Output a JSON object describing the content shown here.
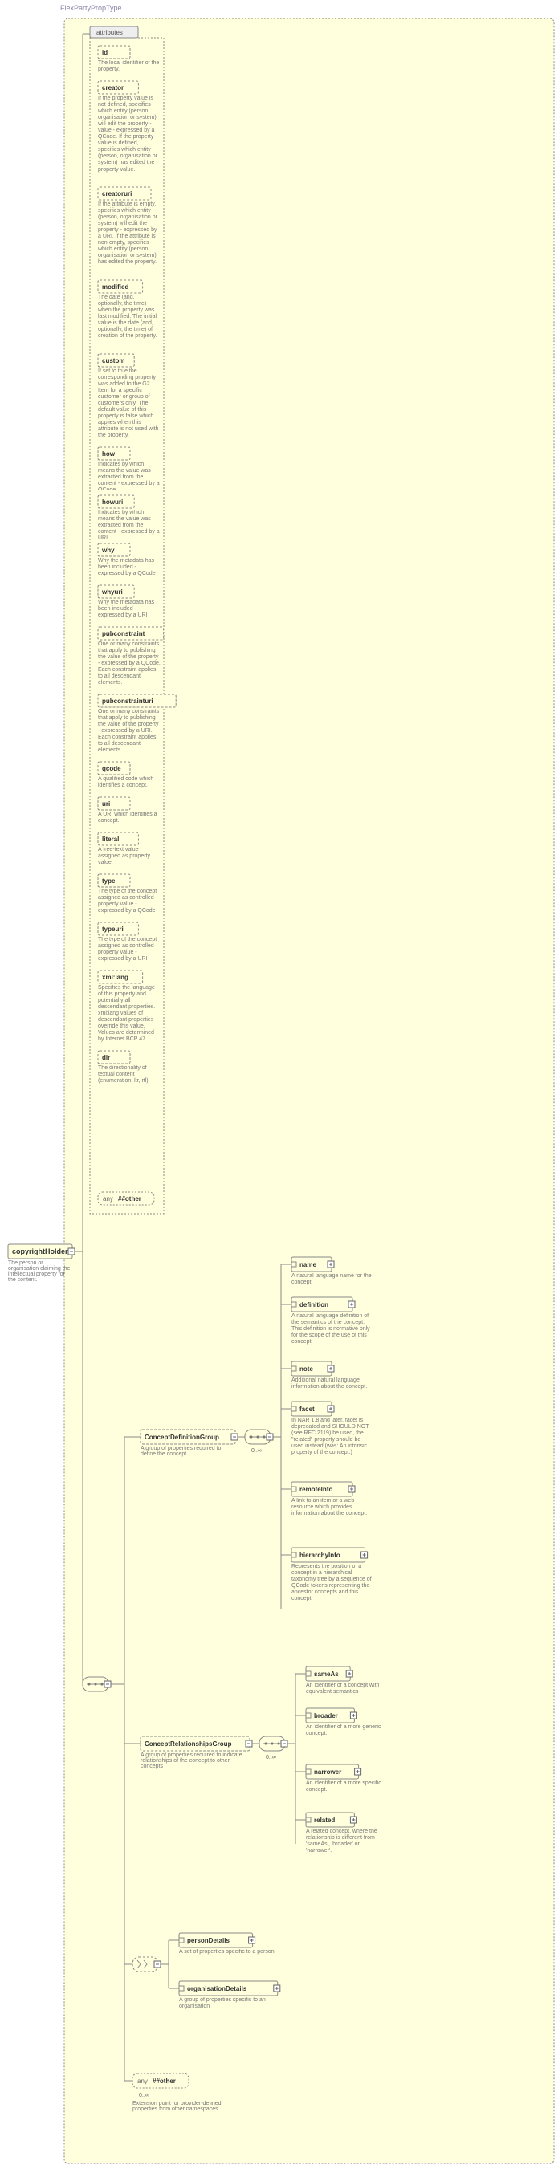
{
  "typeHeader": "FlexPartyPropType",
  "root": {
    "name": "copyrightHolder",
    "doc": "The person or organisation claiming the intellectual property for the content."
  },
  "attributesHeader": "attributes",
  "attributes": [
    {
      "name": "id",
      "doc": "The local identifier of the property."
    },
    {
      "name": "creator",
      "doc": "If the property value is not defined, specifies which entity (person, organisation or system) will edit the property - value - expressed by a QCode. If the property value is defined, specifies which entity (person, organisation or system) has edited the property value."
    },
    {
      "name": "creatoruri",
      "doc": "If the attribute is empty, specifies which entity (person, organisation or system) will edit the property - expressed by a URI. If the attribute is non-empty, specifies which entity (person, organisation or system) has edited the property."
    },
    {
      "name": "modified",
      "doc": "The date (and, optionally, the time) when the property was last modified. The initial value is the date (and, optionally, the time) of creation of the property."
    },
    {
      "name": "custom",
      "doc": "If set to true the corresponding property was added to the G2 Item for a specific customer or group of customers only. The default value of this property is false which applies when this attribute is not used with the property."
    },
    {
      "name": "how",
      "doc": "Indicates by which means the value was extracted from the content - expressed by a QCode"
    },
    {
      "name": "howuri",
      "doc": "Indicates by which means the value was extracted from the content - expressed by a URI"
    },
    {
      "name": "why",
      "doc": "Why the metadata has been included - expressed by a QCode"
    },
    {
      "name": "whyuri",
      "doc": "Why the metadata has been included - expressed by a URI"
    },
    {
      "name": "pubconstraint",
      "doc": "One or many constraints that apply to publishing the value of the property - expressed by a QCode. Each constraint applies to all descendant elements."
    },
    {
      "name": "pubconstrainturi",
      "doc": "One or many constraints that apply to publishing the value of the property - expressed by a URI. Each constraint applies to all descendant elements."
    },
    {
      "name": "qcode",
      "doc": "A qualified code which identifies a concept."
    },
    {
      "name": "uri",
      "doc": "A URI which identifies a concept."
    },
    {
      "name": "literal",
      "doc": "A free-text value assigned as property value."
    },
    {
      "name": "type",
      "doc": "The type of the concept assigned as controlled property value - expressed by a QCode"
    },
    {
      "name": "typeuri",
      "doc": "The type of the concept assigned as controlled property value - expressed by a URI"
    },
    {
      "name": "xml:lang",
      "doc": "Specifies the language of this property and potentially all descendant properties. xml:lang values of descendant properties override this value. Values are determined by Internet BCP 47."
    },
    {
      "name": "dir",
      "doc": "The directionality of textual content (enumeration: ltr, rtl)"
    }
  ],
  "attrWildcard": "##other",
  "conceptDef": {
    "name": "ConceptDefinitionGroup",
    "doc": "A group of properties required to define the concept",
    "occ": "0..∞",
    "children": [
      {
        "name": "name",
        "doc": "A natural language name for the concept."
      },
      {
        "name": "definition",
        "doc": "A natural language definition of the semantics of the concept. This definition is normative only for the scope of the use of this concept."
      },
      {
        "name": "note",
        "doc": "Additional natural language information about the concept."
      },
      {
        "name": "facet",
        "doc": "In NAR 1.8 and later, facet is deprecated and SHOULD NOT (see RFC 2119) be used, the \"related\" property should be used instead.(was: An intrinsic property of the concept.)"
      },
      {
        "name": "remoteInfo",
        "doc": "A link to an item or a web resource which provides information about the concept."
      },
      {
        "name": "hierarchyInfo",
        "doc": "Represents the position of a concept in a hierarchical taxonomy tree by a sequence of QCode tokens representing the ancestor concepts and this concept"
      }
    ]
  },
  "conceptRel": {
    "name": "ConceptRelationshipsGroup",
    "doc": "A group of properties required to indicate relationships of the concept to other concepts",
    "occ": "0..∞",
    "children": [
      {
        "name": "sameAs",
        "doc": "An identifier of a concept with equivalent semantics"
      },
      {
        "name": "broader",
        "doc": "An identifier of a more generic concept."
      },
      {
        "name": "narrower",
        "doc": "An identifier of a more specific concept."
      },
      {
        "name": "related",
        "doc": "A related concept, where the relationship is different from 'sameAs', 'broader' or 'narrower'."
      }
    ]
  },
  "choice": {
    "children": [
      {
        "name": "personDetails",
        "doc": "A set of properties specific to a person"
      },
      {
        "name": "organisationDetails",
        "doc": "A group of properties specific to an organisation"
      }
    ]
  },
  "finalWildcard": {
    "suffix": "##other",
    "occ": "0..∞",
    "doc": "Extension point for provider-defined properties from other namespaces"
  },
  "anyLabel": "any"
}
